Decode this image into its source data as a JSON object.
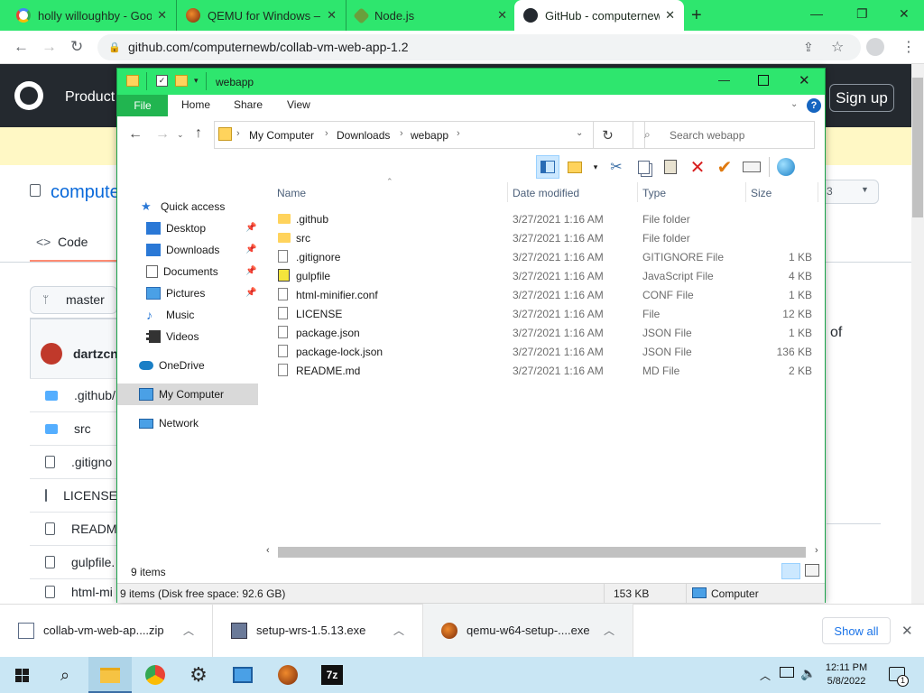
{
  "browser": {
    "tabs": [
      {
        "title": "holly willoughby - Goo",
        "icon": "google-g-icon"
      },
      {
        "title": "QEMU for Windows – I",
        "icon": "qemu-icon"
      },
      {
        "title": "Node.js",
        "icon": "nodejs-icon"
      },
      {
        "title": "GitHub - computernew",
        "icon": "github-icon",
        "active": true
      }
    ],
    "url": "github.com/computernewb/collab-vm-web-app-1.2"
  },
  "github": {
    "nav_product": "Product",
    "sign_up": "Sign up",
    "repo_owner": "compute",
    "code_tab": "Code",
    "branch": "master",
    "author": "dartzcn",
    "right_text": "of",
    "count_badge": "3",
    "files": [
      ".github/",
      "src",
      ".gitigno",
      "LICENSE",
      "READM",
      "gulpfile.",
      "html-mi"
    ]
  },
  "explorer": {
    "title": "webapp",
    "ribbon_tabs": [
      "File",
      "Home",
      "Share",
      "View"
    ],
    "breadcrumb": [
      "My Computer",
      "Downloads",
      "webapp"
    ],
    "search_placeholder": "Search webapp",
    "nav": {
      "quick_access": "Quick access",
      "items": [
        {
          "label": "Desktop",
          "pinned": true
        },
        {
          "label": "Downloads",
          "pinned": true
        },
        {
          "label": "Documents",
          "pinned": true
        },
        {
          "label": "Pictures",
          "pinned": true
        },
        {
          "label": "Music",
          "pinned": false
        },
        {
          "label": "Videos",
          "pinned": false
        }
      ],
      "onedrive": "OneDrive",
      "my_computer": "My Computer",
      "network": "Network"
    },
    "columns": {
      "name": "Name",
      "date": "Date modified",
      "type": "Type",
      "size": "Size"
    },
    "files": [
      {
        "name": ".github",
        "date": "3/27/2021 1:16 AM",
        "type": "File folder",
        "size": "",
        "kind": "folder"
      },
      {
        "name": "src",
        "date": "3/27/2021 1:16 AM",
        "type": "File folder",
        "size": "",
        "kind": "folder"
      },
      {
        "name": ".gitignore",
        "date": "3/27/2021 1:16 AM",
        "type": "GITIGNORE File",
        "size": "1 KB",
        "kind": "file"
      },
      {
        "name": "gulpfile",
        "date": "3/27/2021 1:16 AM",
        "type": "JavaScript File",
        "size": "4 KB",
        "kind": "js"
      },
      {
        "name": "html-minifier.conf",
        "date": "3/27/2021 1:16 AM",
        "type": "CONF File",
        "size": "1 KB",
        "kind": "file"
      },
      {
        "name": "LICENSE",
        "date": "3/27/2021 1:16 AM",
        "type": "File",
        "size": "12 KB",
        "kind": "file"
      },
      {
        "name": "package.json",
        "date": "3/27/2021 1:16 AM",
        "type": "JSON File",
        "size": "1 KB",
        "kind": "file"
      },
      {
        "name": "package-lock.json",
        "date": "3/27/2021 1:16 AM",
        "type": "JSON File",
        "size": "136 KB",
        "kind": "file"
      },
      {
        "name": "README.md",
        "date": "3/27/2021 1:16 AM",
        "type": "MD File",
        "size": "2 KB",
        "kind": "file"
      }
    ],
    "item_count": "9 items",
    "status_items": "9 items (Disk free space: 92.6 GB)",
    "status_size": "153 KB",
    "status_location": "Computer"
  },
  "downloads": [
    {
      "name": "collab-vm-web-ap....zip",
      "icon": "zip-file-icon"
    },
    {
      "name": "setup-wrs-1.5.13.exe",
      "icon": "installer-icon"
    },
    {
      "name": "qemu-w64-setup-....exe",
      "icon": "qemu-icon"
    }
  ],
  "show_all": "Show all",
  "taskbar": {
    "time": "12:11 PM",
    "date": "5/8/2022",
    "notifications": "1"
  }
}
